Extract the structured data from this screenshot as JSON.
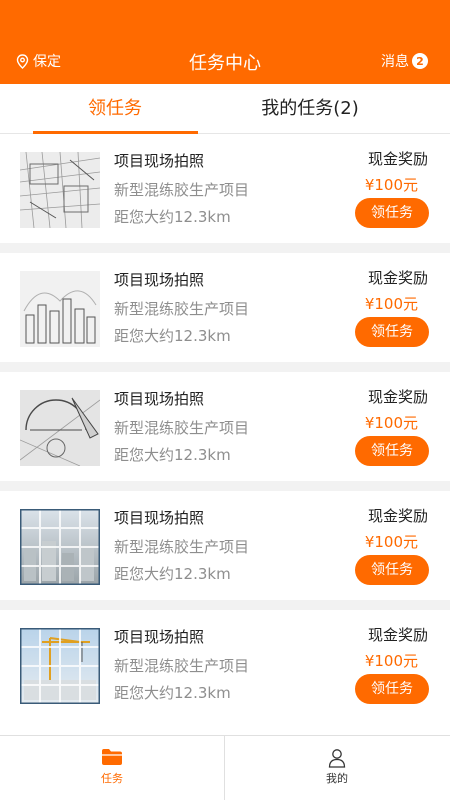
{
  "header": {
    "location": "保定",
    "title": "任务中心",
    "messages_label": "消息",
    "messages_badge": "2",
    "bg_color": "#ff6a00"
  },
  "tabs": [
    {
      "label": "领任务",
      "active": true
    },
    {
      "label": "我的任务(2)",
      "active": false
    }
  ],
  "tasks": [
    {
      "title": "项目现场拍照",
      "project": "新型混练胶生产项目",
      "distance": "距您大约12.3km",
      "reward_label": "现金奖励",
      "price": "¥100元",
      "button": "领任务",
      "thumb": "sketch-drawing-image"
    },
    {
      "title": "项目现场拍照",
      "project": "新型混练胶生产项目",
      "distance": "距您大约12.3km",
      "reward_label": "现金奖励",
      "price": "¥100元",
      "button": "领任务",
      "thumb": "city-sketch-image"
    },
    {
      "title": "项目现场拍照",
      "project": "新型混练胶生产项目",
      "distance": "距您大约12.3km",
      "reward_label": "现金奖励",
      "price": "¥100元",
      "button": "领任务",
      "thumb": "drafting-tools-image"
    },
    {
      "title": "项目现场拍照",
      "project": "新型混练胶生产项目",
      "distance": "距您大约12.3km",
      "reward_label": "现金奖励",
      "price": "¥100元",
      "button": "领任务",
      "thumb": "city-grid-image"
    },
    {
      "title": "项目现场拍照",
      "project": "新型混练胶生产项目",
      "distance": "距您大约12.3km",
      "reward_label": "现金奖励",
      "price": "¥100元",
      "button": "领任务",
      "thumb": "crane-grid-image"
    }
  ],
  "bottom_nav": [
    {
      "label": "任务",
      "icon": "folder-icon",
      "active": true
    },
    {
      "label": "我的",
      "icon": "user-icon",
      "active": false
    }
  ],
  "colors": {
    "accent": "#ff6a00",
    "muted_text": "#8e8e8e",
    "separator": "#f2f2f2"
  }
}
